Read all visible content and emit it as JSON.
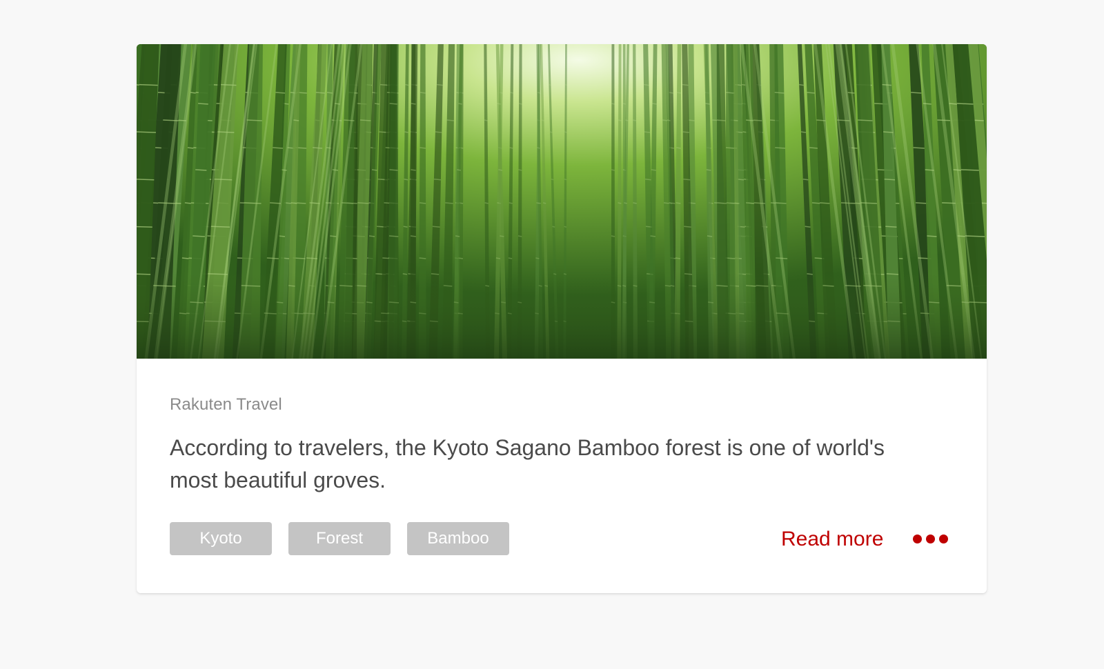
{
  "card": {
    "image_alt": "Bamboo forest",
    "source": "Rakuten Travel",
    "headline": "According to travelers, the Kyoto Sagano Bamboo forest is one of world's most beautiful groves.",
    "tags": [
      {
        "label": "Kyoto"
      },
      {
        "label": "Forest"
      },
      {
        "label": "Bamboo"
      }
    ],
    "read_more_label": "Read more",
    "more_icon": "more-dots-icon"
  },
  "colors": {
    "accent": "#bf0000",
    "tag_bg": "#c4c4c4",
    "source_text": "#8a8a8a",
    "headline_text": "#4a4a4a",
    "page_bg": "#f8f8f8"
  }
}
